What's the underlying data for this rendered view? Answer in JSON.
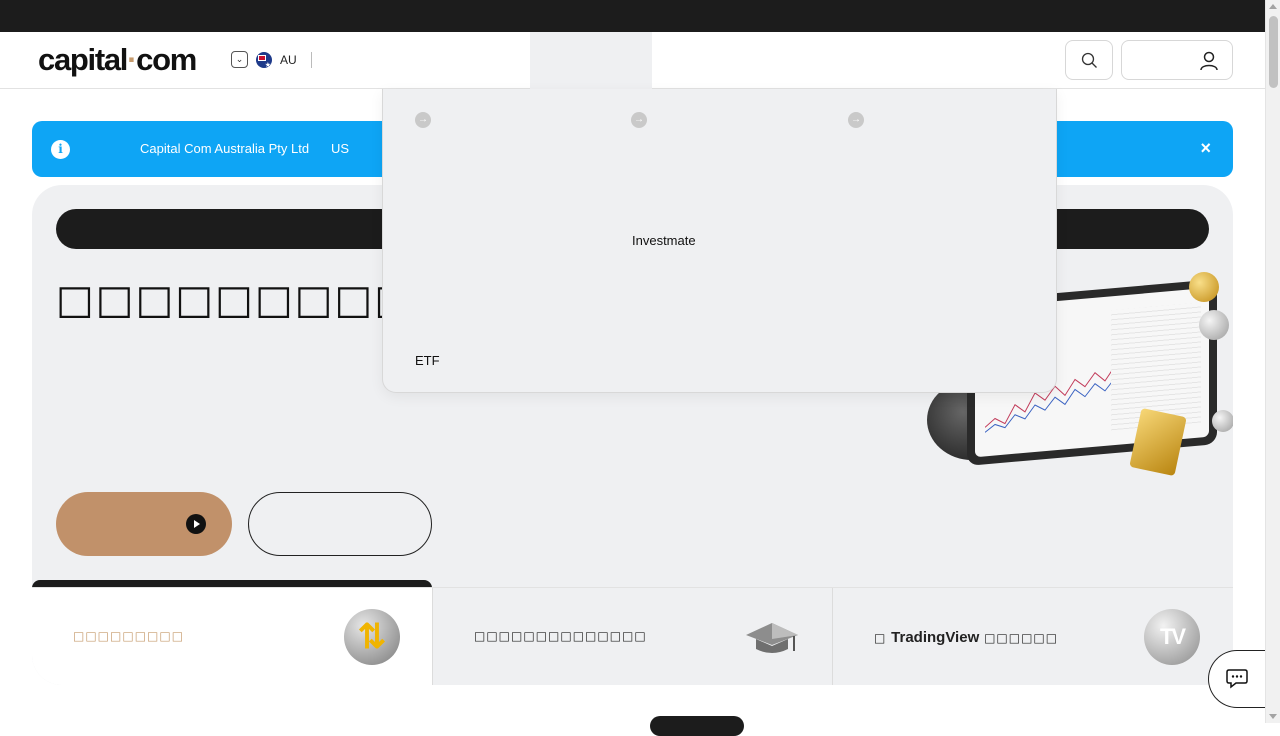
{
  "header": {
    "logo_main": "capital",
    "logo_dot": "·",
    "logo_tail": "com",
    "region_code": "AU"
  },
  "banner": {
    "info_icon": "i",
    "company_text": "Capital Com Australia Pty Ltd",
    "extra_text": "US",
    "close_icon": "×"
  },
  "hero": {
    "title": "□□□□□□□□□□"
  },
  "dropdown": {
    "center_item": "Investmate",
    "bottom_left_item": "ETF",
    "arrow_icon": "→"
  },
  "tabs": [
    {
      "label": "□□□□□□□□□"
    },
    {
      "label": "□□□□□□□□□□□□□□"
    },
    {
      "label_prefix": "□ ",
      "label_brand": "TradingView",
      "label_suffix": " □□□□□□"
    }
  ],
  "colors": {
    "accent": "#c1916a",
    "banner": "#0ea5f5",
    "dark": "#1c1c1c",
    "panel": "#eff0f2"
  }
}
